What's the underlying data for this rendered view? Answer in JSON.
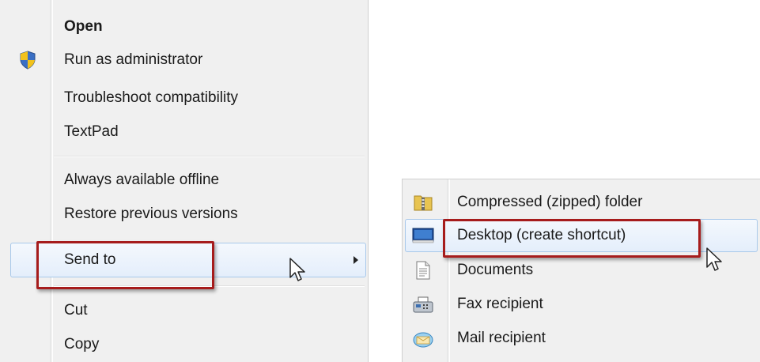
{
  "context_menu": {
    "items": [
      {
        "label": "Open",
        "bold": true
      },
      {
        "label": "Run as administrator"
      },
      {
        "label": "Troubleshoot compatibility"
      },
      {
        "label": "TextPad"
      },
      {
        "label": "Always available offline"
      },
      {
        "label": "Restore previous versions"
      },
      {
        "label": "Send to"
      },
      {
        "label": "Cut"
      },
      {
        "label": "Copy"
      }
    ]
  },
  "send_to_menu": {
    "items": [
      {
        "label": "Compressed (zipped) folder",
        "icon": "zip-folder-icon"
      },
      {
        "label": "Desktop (create shortcut)",
        "icon": "desktop-icon"
      },
      {
        "label": "Documents",
        "icon": "documents-icon"
      },
      {
        "label": "Fax recipient",
        "icon": "fax-icon"
      },
      {
        "label": "Mail recipient",
        "icon": "mail-icon"
      }
    ]
  },
  "colors": {
    "menu_background": "#f0f0f0",
    "highlight_border": "#a8c8ea",
    "callout_red": "#a61c1c"
  }
}
